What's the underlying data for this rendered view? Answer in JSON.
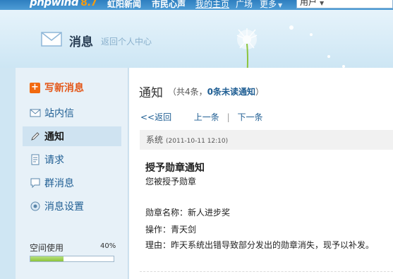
{
  "topbar": {
    "logo_text": "phpwind",
    "logo_version": "8.7",
    "nav": [
      {
        "label": "虹阳新闻"
      },
      {
        "label": "市民心声"
      },
      {
        "label": "我的主页"
      },
      {
        "label": "广场"
      },
      {
        "label": "更多"
      }
    ],
    "user_label": "用户"
  },
  "banner": {
    "title": "消息",
    "back_link": "返回个人中心"
  },
  "sidebar": {
    "compose_label": "写新消息",
    "items": [
      {
        "label": "站内信",
        "icon": "envelope-icon"
      },
      {
        "label": "通知",
        "icon": "pencil-icon"
      },
      {
        "label": "请求",
        "icon": "document-icon"
      },
      {
        "label": "群消息",
        "icon": "chat-bubble-icon"
      },
      {
        "label": "消息设置",
        "icon": "settings-icon"
      }
    ],
    "selected_index": 1,
    "space_label": "空间使用",
    "space_percent_text": "40%",
    "space_used_fraction": 0.4
  },
  "main": {
    "title": "通知",
    "summary_prefix": "（共4条，",
    "summary_unread": "0条未读通知",
    "summary_suffix": "）",
    "pager": {
      "back": "<<返回",
      "prev": "上一条",
      "sep": "|",
      "next": "下一条"
    },
    "message": {
      "category": "系统",
      "time": "(2011-10-11 12:10)",
      "title": "授予勋章通知",
      "line1": "您被授予勋章",
      "medal_line": "勋章名称：新人进步奖",
      "operator_line": "操作：青天剑",
      "reason_line": "理由：昨天系统出错导致部分发出的勋章消失，现予以补发。"
    }
  },
  "colors": {
    "accent_orange": "#e4581a",
    "link_blue": "#1f5e93",
    "topbar_blue": "#3a8acb",
    "progress_green": "#8cc43c"
  }
}
